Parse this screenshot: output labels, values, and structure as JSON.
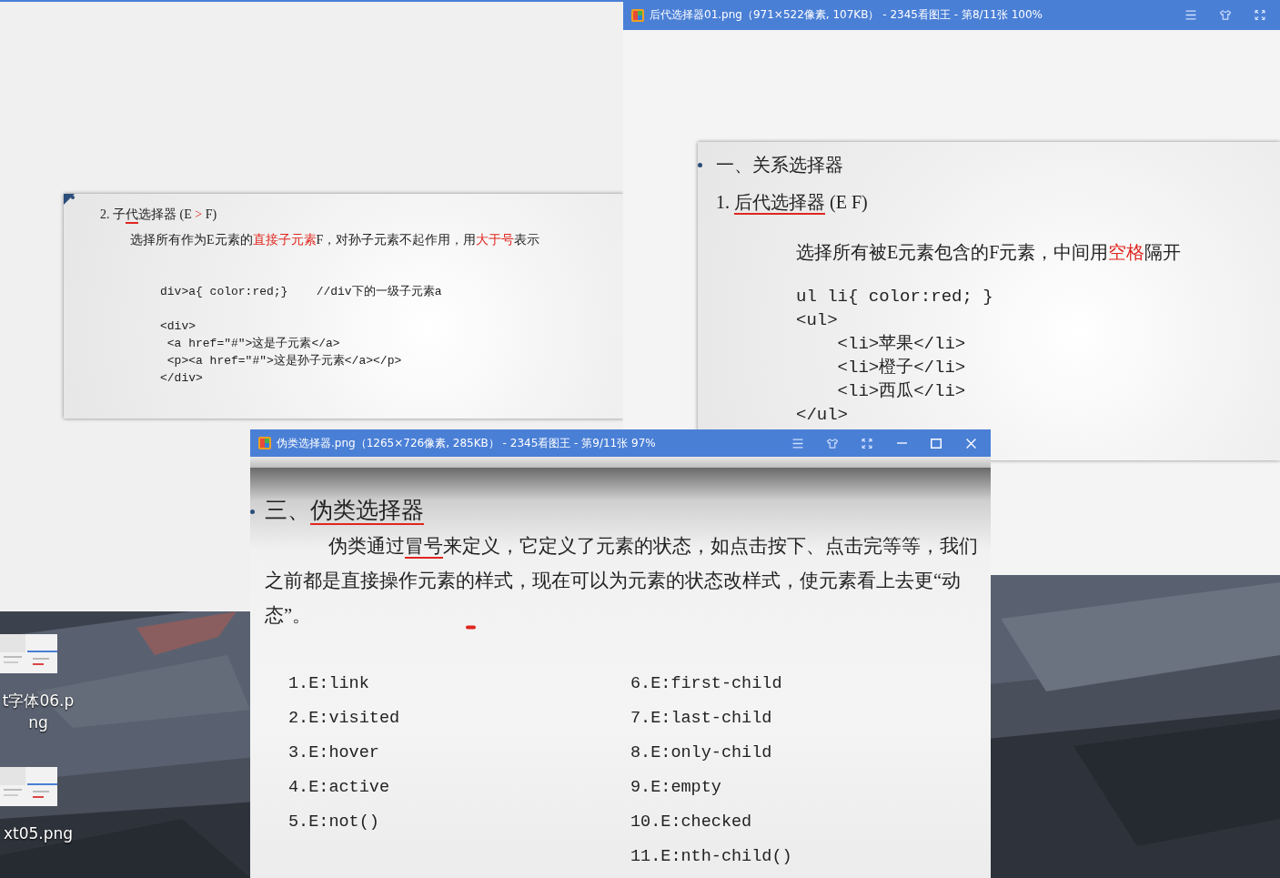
{
  "desktop": {
    "icons": [
      {
        "label": "t字体06.png"
      },
      {
        "label": "xt05.png"
      }
    ]
  },
  "back_slide": {
    "heading": [
      {
        "text": "2. 子",
        "kind": "plain"
      },
      {
        "text": "代",
        "kind": "underlined"
      },
      {
        "text": "选择器 (E ",
        "kind": "plain"
      },
      {
        "text": ">",
        "kind": "emphasis"
      },
      {
        "text": " F)",
        "kind": "plain"
      }
    ],
    "description": [
      {
        "text": "选择所有作为E元素的",
        "kind": "plain"
      },
      {
        "text": "直接子元素",
        "kind": "emphasis"
      },
      {
        "text": "F，对孙子元素不起作用，用",
        "kind": "plain"
      },
      {
        "text": "大于号",
        "kind": "emphasis"
      },
      {
        "text": "表示",
        "kind": "plain"
      }
    ],
    "rule": "div>a{ color:red;}    //div下的一级子元素a",
    "code": [
      "<div>",
      " <a href=\"#\">这是子元素</a>",
      " <p><a href=\"#\">这是孙子元素</a></p>",
      "</div>"
    ]
  },
  "viewer_right": {
    "title": "后代选择器01.png（971×522像素, 107KB） - 2345看图王 - 第8/11张 100%",
    "slide": {
      "section": "一、关系选择器",
      "heading": [
        {
          "text": "1. ",
          "kind": "plain"
        },
        {
          "text": "后代选择器",
          "kind": "underlined"
        },
        {
          "text": " (E F)",
          "kind": "plain"
        }
      ],
      "description": [
        {
          "text": "选择所有被E元素包含的F元素，中间用",
          "kind": "plain"
        },
        {
          "text": "空格",
          "kind": "emphasis"
        },
        {
          "text": "隔开",
          "kind": "plain"
        }
      ],
      "code": [
        "ul li{ color:red; }",
        "<ul>",
        "    <li>苹果</li>",
        "    <li>橙子</li>",
        "    <li>西瓜</li>",
        "</ul>"
      ]
    }
  },
  "viewer_front": {
    "title": "伪类选择器.png（1265×726像素, 285KB） - 2345看图王 - 第9/11张 97%",
    "slide": {
      "heading": [
        {
          "text": "三、",
          "kind": "plain"
        },
        {
          "text": "伪类选择器",
          "kind": "underlined"
        }
      ],
      "paragraph": [
        {
          "text": "伪类通过",
          "kind": "plain"
        },
        {
          "text": "冒号",
          "kind": "underlined"
        },
        {
          "text": "来定义，它定义了元素的状态，如点击按下、点击完等等，我们之前都是直接操作元素的样式，现在可以为元素的状态改样式，使元素看上去更“动态”。",
          "kind": "plain"
        }
      ],
      "columns": [
        {
          "items": [
            "1.E:link",
            "2.E:visited",
            "3.E:hover",
            "4.E:active",
            "5.E:not()"
          ]
        },
        {
          "items": [
            "6.E:first-child",
            "7.E:last-child",
            "8.E:only-child",
            "9.E:empty",
            "10.E:checked",
            "11.E:nth-child()"
          ]
        }
      ]
    }
  }
}
